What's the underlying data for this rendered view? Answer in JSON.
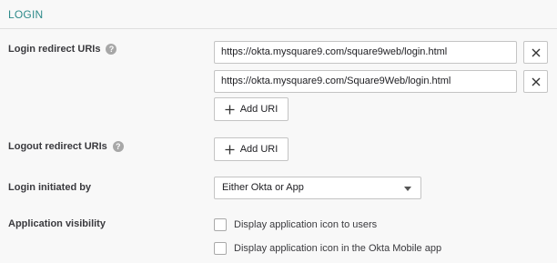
{
  "section": {
    "title": "LOGIN"
  },
  "login_redirect": {
    "label": "Login redirect URIs",
    "uris": [
      "https://okta.mysquare9.com/square9web/login.html",
      "https://okta.mysquare9.com/Square9Web/login.html"
    ],
    "add_label": "Add URI"
  },
  "logout_redirect": {
    "label": "Logout redirect URIs",
    "add_label": "Add URI"
  },
  "login_initiated": {
    "label": "Login initiated by",
    "selected": "Either Okta or App"
  },
  "visibility": {
    "label": "Application visibility",
    "options": [
      {
        "label": "Display application icon to users",
        "checked": false
      },
      {
        "label": "Display application icon in the Okta Mobile app",
        "checked": false
      }
    ]
  },
  "icons": {
    "help": "?",
    "remove": "close-icon",
    "add": "plus-icon"
  },
  "colors": {
    "accent": "#2e8a8a",
    "help_icon": "#a7a7a7"
  }
}
